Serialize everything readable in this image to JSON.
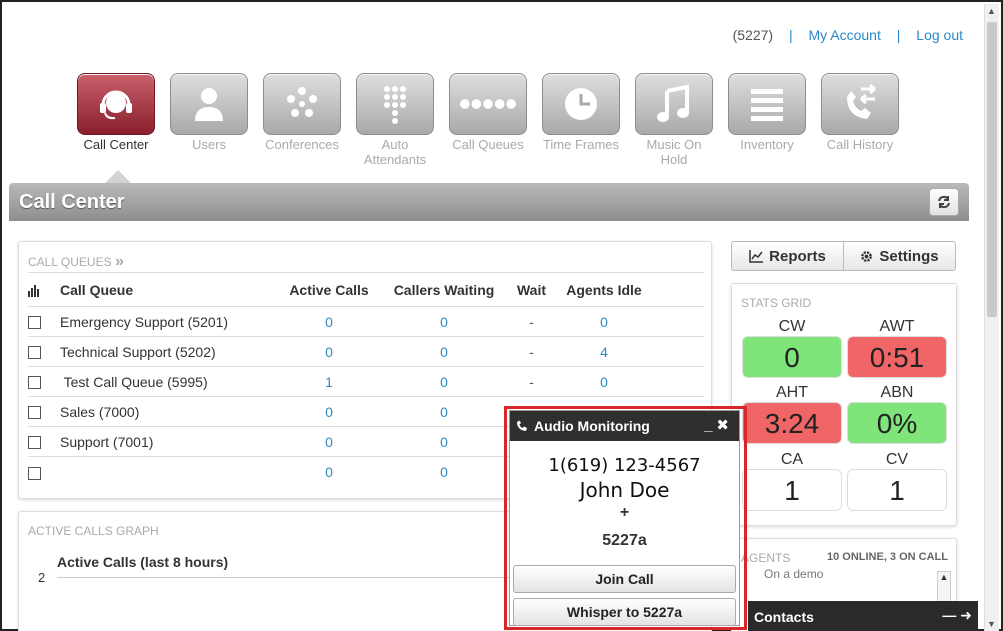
{
  "toplinks": {
    "extension": "(5227)",
    "sep1": "|",
    "my_account": "My Account",
    "sep2": "|",
    "logout": "Log out"
  },
  "nav": {
    "items": [
      {
        "label": "Call Center",
        "icon": "headset-icon"
      },
      {
        "label": "Users",
        "icon": "user-icon"
      },
      {
        "label": "Conferences",
        "icon": "conference-icon"
      },
      {
        "label": "Auto Attendants",
        "icon": "keypad-icon"
      },
      {
        "label": "Call Queues",
        "icon": "queue-dots-icon"
      },
      {
        "label": "Time Frames",
        "icon": "clock-icon"
      },
      {
        "label": "Music On Hold",
        "icon": "music-note-icon"
      },
      {
        "label": "Inventory",
        "icon": "list-icon"
      },
      {
        "label": "Call History",
        "icon": "call-history-icon"
      }
    ]
  },
  "page_title": "Call Center",
  "call_queues": {
    "heading": "Call Queues",
    "heading_suffix": "»",
    "columns": {
      "name": "Call Queue",
      "active": "Active Calls",
      "waiting": "Callers Waiting",
      "wait": "Wait",
      "idle": "Agents Idle"
    },
    "rows": [
      {
        "name": "Emergency Support (5201)",
        "active": "0",
        "waiting": "0",
        "wait": "-",
        "idle": "0"
      },
      {
        "name": "Technical Support (5202)",
        "active": "0",
        "waiting": "0",
        "wait": "-",
        "idle": "4"
      },
      {
        "name": " Test Call Queue (5995)",
        "active": "1",
        "waiting": "0",
        "wait": "-",
        "idle": "0"
      },
      {
        "name": "Sales (7000)",
        "active": "0",
        "waiting": "0",
        "wait": "",
        "idle": ""
      },
      {
        "name": "Support (7001)",
        "active": "0",
        "waiting": "0",
        "wait": "",
        "idle": ""
      },
      {
        "name": "",
        "active": "0",
        "waiting": "0",
        "wait": "",
        "idle": ""
      }
    ]
  },
  "active_calls_graph": {
    "heading": "Active Calls Graph",
    "title": "Active Calls (last 8 hours)",
    "y_tick": "2"
  },
  "buttons": {
    "reports": "Reports",
    "settings": "Settings"
  },
  "stats_grid": {
    "heading": "Stats Grid",
    "cells": [
      {
        "label": "CW",
        "value": "0",
        "color": "#7fe57a"
      },
      {
        "label": "AWT",
        "value": "0:51",
        "color": "#f06565"
      },
      {
        "label": "AHT",
        "value": "3:24",
        "color": "#f06565"
      },
      {
        "label": "ABN",
        "value": "0%",
        "color": "#7fe57a"
      },
      {
        "label": "CA",
        "value": "1",
        "color": "#ffffff"
      },
      {
        "label": "CV",
        "value": "1",
        "color": "#ffffff"
      }
    ]
  },
  "agents": {
    "heading": "Agents",
    "count": "10 Online, 3 On Call",
    "status": "On a demo"
  },
  "contacts": {
    "label": "Contacts",
    "controls": "— ➜"
  },
  "audio_monitoring": {
    "title": "Audio Monitoring",
    "controls": "_✖",
    "phone": "1(619) 123-4567",
    "name": "John Doe",
    "plus": "+",
    "extension": "5227a",
    "join_label": "Join Call",
    "whisper_label": "Whisper to 5227a"
  },
  "colors": {
    "accent": "#2b8ac6",
    "active_tile": "#8a1e2c",
    "highlight": "#d8262b"
  }
}
